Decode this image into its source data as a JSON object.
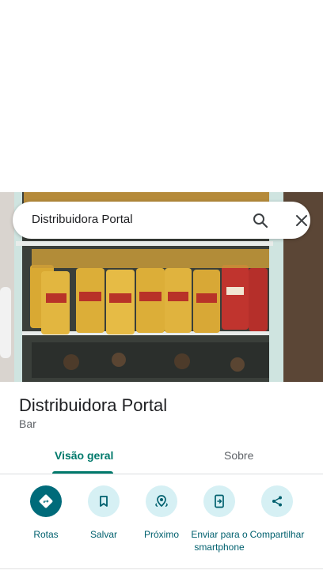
{
  "search": {
    "query": "Distribuidora Portal"
  },
  "place": {
    "name": "Distribuidora Portal",
    "category": "Bar"
  },
  "tabs": [
    {
      "label": "Visão geral",
      "active": true
    },
    {
      "label": "Sobre",
      "active": false
    }
  ],
  "actions": [
    {
      "label": "Rotas",
      "icon": "directions-icon"
    },
    {
      "label": "Salvar",
      "icon": "bookmark-icon"
    },
    {
      "label": "Próximo",
      "icon": "nearby-icon"
    },
    {
      "label": "Enviar para o smartphone",
      "icon": "send-to-phone-icon"
    },
    {
      "label": "Compartilhar",
      "icon": "share-icon"
    }
  ],
  "colors": {
    "accent": "#00796b",
    "action_bg": "#d6f0f4",
    "primary_action": "#006b7a"
  }
}
